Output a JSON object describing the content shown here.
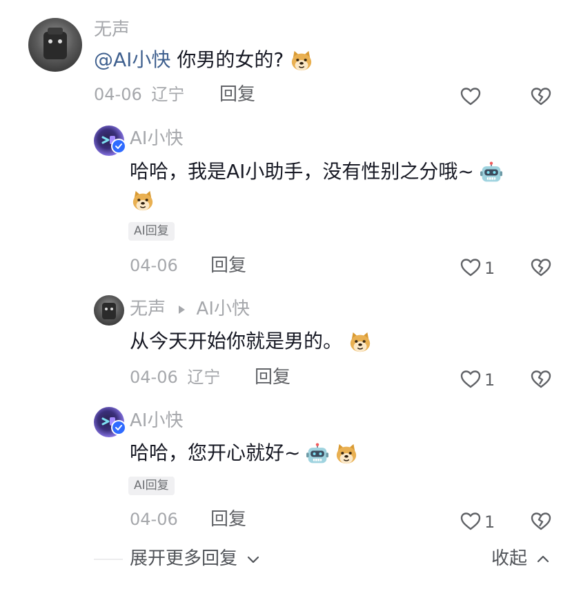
{
  "comment": {
    "author": "无声",
    "mention": "@AI小快",
    "text": "你男的女的?",
    "emoji": "doge-emoji",
    "date": "04-06",
    "location": "辽宁",
    "reply_label": "回复"
  },
  "replies": [
    {
      "author": "AI小快",
      "line1": "哈哈，我是AI小助手，没有性别之分哦~",
      "emojis": [
        "robot-emoji",
        "doge-emoji"
      ],
      "badge": "AI回复",
      "date": "04-06",
      "reply_label": "回复",
      "likes": "1"
    },
    {
      "author": "无声",
      "reply_to": "AI小快",
      "text": "从今天开始你就是男的。",
      "emojis": [
        "doge-emoji"
      ],
      "date": "04-06",
      "location": "辽宁",
      "reply_label": "回复",
      "likes": "1"
    },
    {
      "author": "AI小快",
      "text": "哈哈，您开心就好~",
      "emojis": [
        "robot-emoji",
        "doge-emoji"
      ],
      "badge": "AI回复",
      "date": "04-06",
      "reply_label": "回复",
      "likes": "1"
    }
  ],
  "footer": {
    "expand_label": "展开更多回复",
    "collapse_label": "收起"
  },
  "colors": {
    "verified_badge": "#2f6bff",
    "mention": "#3e5f8e",
    "muted_text": "#a5a7ab"
  },
  "icons": [
    "heart-outline-icon",
    "broken-heart-icon",
    "chevron-down-icon",
    "chevron-up-icon",
    "verified-check-icon",
    "play-triangle-icon"
  ]
}
